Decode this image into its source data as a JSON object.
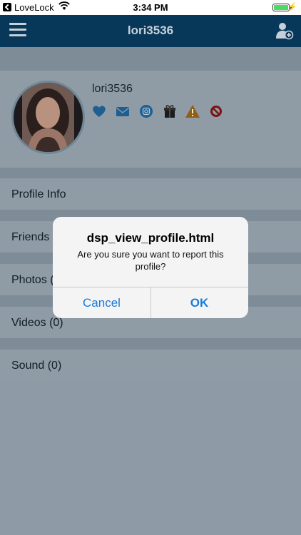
{
  "status_bar": {
    "back_app": "LoveLock",
    "time": "3:34 PM",
    "battery_level": 1.0
  },
  "navbar": {
    "title": "lori3536"
  },
  "profile": {
    "username": "lori3536",
    "actions": [
      "heart-icon",
      "message-icon",
      "instagram-icon",
      "gift-icon",
      "report-icon",
      "block-icon"
    ]
  },
  "menu": {
    "rows": [
      {
        "label": "Profile Info"
      },
      {
        "label": "Friends (0)"
      },
      {
        "label": "Photos (0)"
      },
      {
        "label": "Videos (0)"
      },
      {
        "label": "Sound (0)"
      }
    ]
  },
  "dialog": {
    "title": "dsp_view_profile.html",
    "message": "Are you sure you want to report this profile?",
    "cancel_label": "Cancel",
    "ok_label": "OK"
  },
  "colors": {
    "navbar": "#07385a",
    "accent": "#1a7cd8",
    "overlay_bg": "#8e9aa5"
  }
}
